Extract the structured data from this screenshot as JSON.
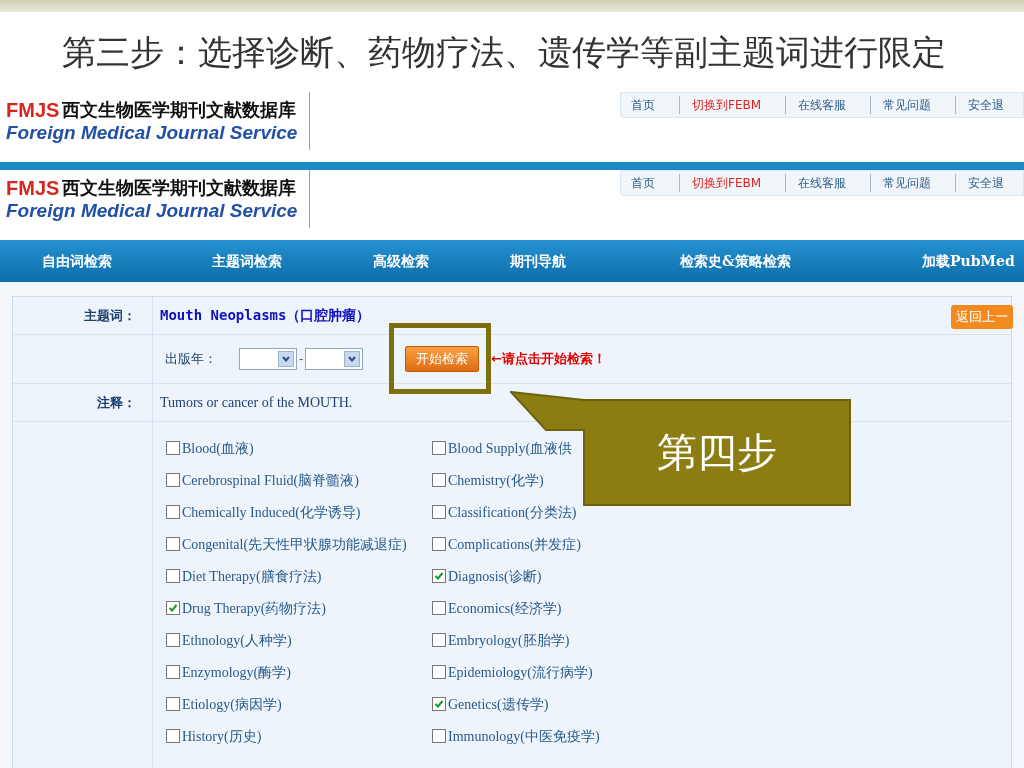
{
  "slide_title": "第三步：选择诊断、药物疗法、遗传学等副主题词进行限定",
  "headers": [
    {
      "logo_code": "FMJS",
      "logo_cn": "西文生物医学期刊文献数据库",
      "logo_en": "Foreign Medical Journal Service",
      "links": [
        {
          "label": "首页",
          "kind": "normal"
        },
        {
          "label": "切换到FEBM",
          "kind": "highlight"
        },
        {
          "label": "在线客服",
          "kind": "normal"
        },
        {
          "label": "常见问题",
          "kind": "normal"
        },
        {
          "label": "安全退",
          "kind": "normal"
        }
      ]
    },
    {
      "logo_code": "FMJS",
      "logo_cn": "西文生物医学期刊文献数据库",
      "logo_en": "Foreign Medical Journal Service",
      "links": [
        {
          "label": "首页",
          "kind": "normal"
        },
        {
          "label": "切换到FEBM",
          "kind": "highlight"
        },
        {
          "label": "在线客服",
          "kind": "normal"
        },
        {
          "label": "常见问题",
          "kind": "normal"
        },
        {
          "label": "安全退",
          "kind": "normal"
        }
      ]
    }
  ],
  "nav": [
    "自由词检索",
    "主题词检索",
    "高级检索",
    "期刊导航",
    "检索史&策略检索",
    "加载PubMed"
  ],
  "form": {
    "subject_label": "主题词：",
    "subject_value": "Mouth Neoplasms（口腔肿瘤）",
    "back_button": "返回上一",
    "year_label": "出版年：",
    "year_separator": "-",
    "search_button": "开始检索",
    "hint": "←请点击开始检索！",
    "note_label": "注释：",
    "note": "Tumors or cancer of the MOUTH."
  },
  "subheadings": [
    {
      "label": "Blood(血液)",
      "checked": false
    },
    {
      "label": "Blood Supply(血液供",
      "checked": false
    },
    {
      "label": "Cerebrospinal Fluid(脑脊髓液)",
      "checked": false
    },
    {
      "label": "Chemistry(化学)",
      "checked": false
    },
    {
      "label": "Chemically Induced(化学诱导)",
      "checked": false
    },
    {
      "label": "Classification(分类法)",
      "checked": false
    },
    {
      "label": "Congenital(先天性甲状腺功能减退症)",
      "checked": false
    },
    {
      "label": "Complications(并发症)",
      "checked": false
    },
    {
      "label": "Diet Therapy(膳食疗法)",
      "checked": false
    },
    {
      "label": "Diagnosis(诊断)",
      "checked": true
    },
    {
      "label": "Drug Therapy(药物疗法)",
      "checked": true
    },
    {
      "label": "Economics(经济学)",
      "checked": false
    },
    {
      "label": "Ethnology(人种学)",
      "checked": false
    },
    {
      "label": "Embryology(胚胎学)",
      "checked": false
    },
    {
      "label": "Enzymology(酶学)",
      "checked": false
    },
    {
      "label": "Epidemiology(流行病学)",
      "checked": false
    },
    {
      "label": "Etiology(病因学)",
      "checked": false
    },
    {
      "label": "Genetics(遗传学)",
      "checked": true
    },
    {
      "label": "History(历史)",
      "checked": false
    },
    {
      "label": "Immunology(中医免疫学)",
      "checked": false
    }
  ],
  "callout": {
    "text": "第四步"
  }
}
